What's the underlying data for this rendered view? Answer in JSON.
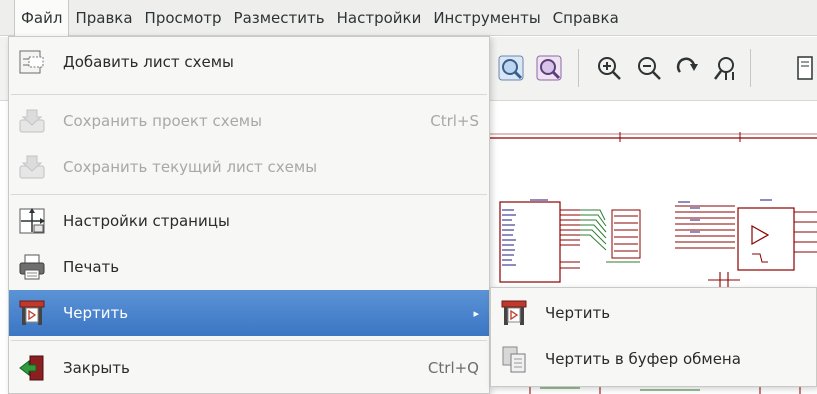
{
  "menubar": {
    "items": [
      {
        "label": "Файл"
      },
      {
        "label": "Правка"
      },
      {
        "label": "Просмотр"
      },
      {
        "label": "Разместить"
      },
      {
        "label": "Настройки"
      },
      {
        "label": "Инструменты"
      },
      {
        "label": "Справка"
      }
    ]
  },
  "file_menu": {
    "items": [
      {
        "label": "Добавить лист схемы",
        "shortcut": "",
        "icon": "add-sheet-icon",
        "enabled": true
      },
      {
        "label": "Сохранить проект схемы",
        "shortcut": "Ctrl+S",
        "icon": "save-project-icon",
        "enabled": false
      },
      {
        "label": "Сохранить текущий лист схемы",
        "shortcut": "",
        "icon": "save-sheet-icon",
        "enabled": false
      },
      {
        "label": "Настройки страницы",
        "shortcut": "",
        "icon": "page-settings-icon",
        "enabled": true
      },
      {
        "label": "Печать",
        "shortcut": "",
        "icon": "printer-icon",
        "enabled": true
      },
      {
        "label": "Чертить",
        "shortcut": "",
        "icon": "plot-icon",
        "enabled": true,
        "has_submenu": true
      },
      {
        "label": "Закрыть",
        "shortcut": "Ctrl+Q",
        "icon": "exit-icon",
        "enabled": true
      }
    ]
  },
  "plot_submenu": {
    "items": [
      {
        "label": "Чертить",
        "icon": "plot-icon"
      },
      {
        "label": "Чертить в буфер обмена",
        "icon": "clipboard-icon"
      }
    ]
  },
  "colors": {
    "highlight": "#3b76c4",
    "schematic_wire": "#8b0000",
    "schematic_green": "#2e7d32",
    "schematic_navy": "#1a1a80"
  }
}
